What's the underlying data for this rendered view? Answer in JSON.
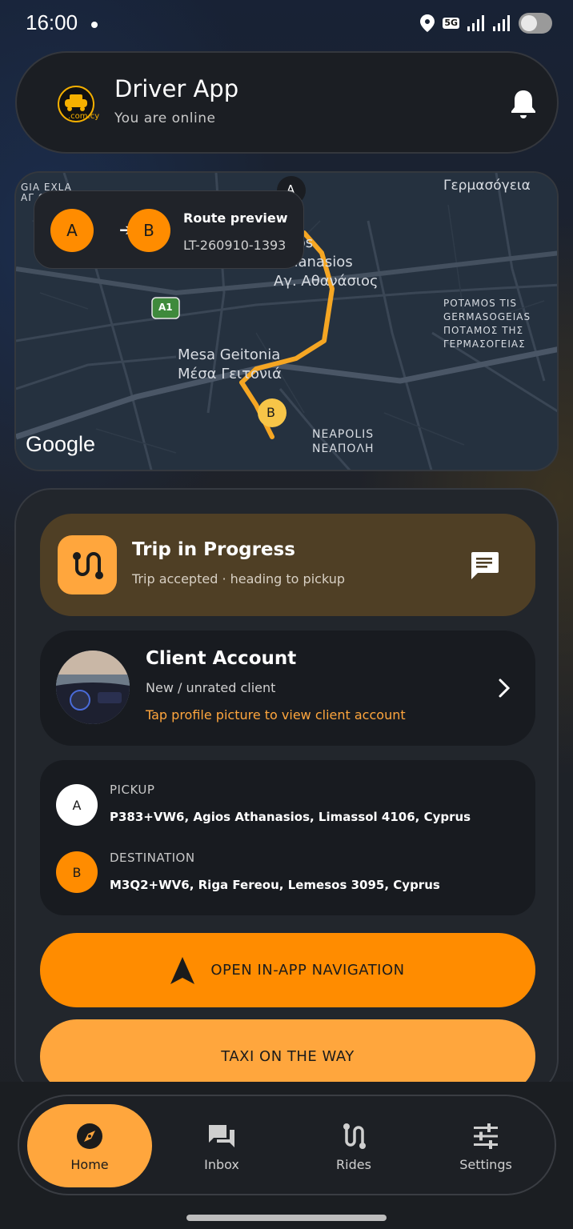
{
  "status": {
    "time": "16:00",
    "network": "5G"
  },
  "header": {
    "title": "Driver App",
    "subtitle": "You are online",
    "logo_text": ".com.cy"
  },
  "map": {
    "labels": {
      "gia_exla": "GIA EXLA\nΑΓ ΟΥΛΑ",
      "germasogeia": "Γερμασόγεια",
      "agios": "Agios\nAthanasios\nΑγ. Αθανάσιος",
      "potamos": "POTAMOS TIS\nGERMASOGEIAS\nΠΟΤΑΜΟΣ ΤΗΣ\nΓΕΡΜΑΣΟΓΕΙΑΣ",
      "mesa": "Mesa Geitonia\nΜέσα Γειτονιά",
      "neapolis": "NEAPOLIS\nΝΕΑΠΟΛΗ",
      "road_a1": "A1",
      "google": "Google",
      "pin_a": "A",
      "pin_b": "B"
    },
    "route_card": {
      "from": "A",
      "to": "B",
      "title": "Route preview",
      "id": "LT-260910-1393"
    }
  },
  "trip": {
    "title": "Trip in Progress",
    "subtitle": "Trip accepted · heading to pickup"
  },
  "client": {
    "title": "Client Account",
    "subtitle": "New / unrated client",
    "link": "Tap profile picture to view client account"
  },
  "addresses": {
    "pickup": {
      "marker": "A",
      "label": "PICKUP",
      "value": "P383+VW6, Agios Athanasios, Limassol 4106, Cyprus"
    },
    "destination": {
      "marker": "B",
      "label": "DESTINATION",
      "value": "M3Q2+WV6, Riga Fereou, Lemesos 3095, Cyprus"
    }
  },
  "buttons": {
    "navigation": "OPEN IN-APP NAVIGATION",
    "taxi": "TAXI ON THE WAY"
  },
  "nav": [
    {
      "label": "Home",
      "icon": "compass-icon",
      "active": true
    },
    {
      "label": "Inbox",
      "icon": "chat-icon",
      "active": false
    },
    {
      "label": "Rides",
      "icon": "route-icon",
      "active": false
    },
    {
      "label": "Settings",
      "icon": "sliders-icon",
      "active": false
    }
  ],
  "colors": {
    "accent": "#ff8c00",
    "accent_light": "#ffa63d",
    "route": "#f5a623"
  }
}
